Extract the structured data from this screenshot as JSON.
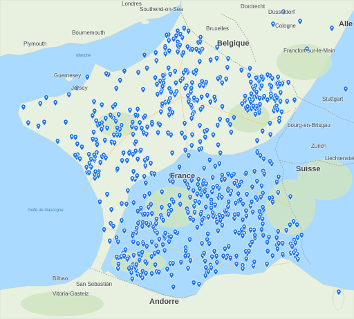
{
  "colors": {
    "water": "#aadaff",
    "land": "#e8f0e0",
    "forest": "#cfe5c1",
    "border": "#9e9e9e",
    "pin": "#1a73e8",
    "pin_dot": "#ffffff",
    "road": "#f5d38a"
  },
  "icons": {
    "marker": "map-marker-icon"
  },
  "labels": {
    "londres": "Londres",
    "southend": "Southend-on-Sea",
    "bournemouth": "Bournemouth",
    "plymouth": "Plymouth",
    "guernesey": "Guernesey",
    "jersey": "Jersey",
    "bruxelles": "Bruxelles",
    "belgique": "Belgique",
    "dusseldorf": "Düsseldorf",
    "cologne": "Cologne",
    "dordrecht": "Dordrecht",
    "francfort": "Francfort-sur-le-Main",
    "alle": "Alle",
    "stuttgart": "Stuttgart",
    "fribourg": "bourg-en-Brisgau",
    "zurich": "Zurich",
    "liechtenstein": "Liechtenstein",
    "suisse": "Suisse",
    "france": "France",
    "bilbao": "Bilbao",
    "sebastien": "San Sebastián",
    "vitoria": "Vitoria-Gasteiz",
    "andorre": "Andorre",
    "golfe": "Golfe de Gascogne",
    "manche": "Manche"
  },
  "marker_count": 720
}
